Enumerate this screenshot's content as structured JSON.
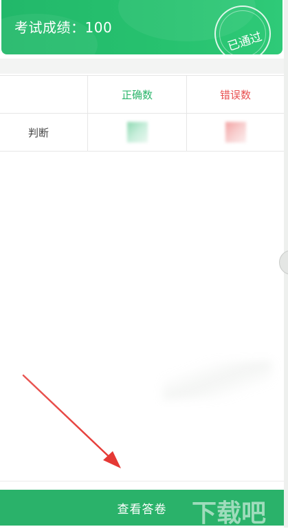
{
  "banner": {
    "score_text": "考试成绩：100",
    "pass_stamp": "已通过",
    "accent": "#27c26f"
  },
  "stats_table": {
    "headers": [
      "",
      "正确数",
      "错误数"
    ],
    "rows": [
      {
        "type": "判断",
        "correct": "",
        "wrong": ""
      }
    ],
    "correct_color": "#2bb56b",
    "wrong_color": "#e85050"
  },
  "actions": {
    "view_answers_label": "查看答卷",
    "button_color": "#2ab26a"
  },
  "watermark": {
    "text": "下载吧"
  },
  "annotation": {
    "arrow_color": "#e53935",
    "icon": "red-arrow-icon"
  }
}
